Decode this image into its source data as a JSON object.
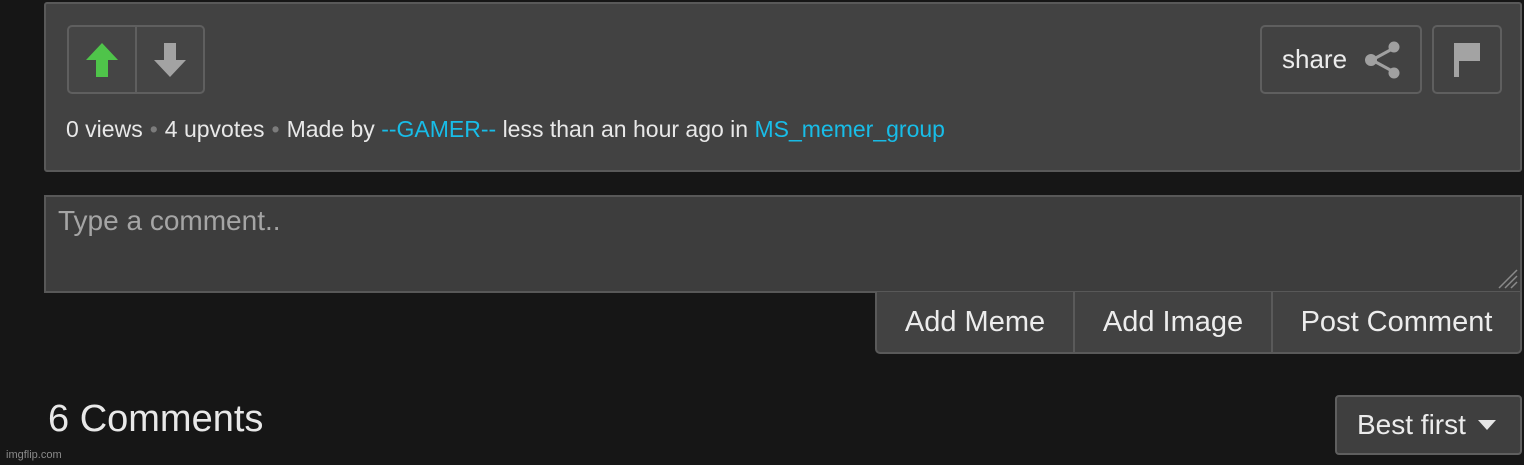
{
  "post": {
    "views": "0 views",
    "separator": "•",
    "upvotes": "4 upvotes",
    "made_by_label": "Made by",
    "author": "--GAMER--",
    "time_text": "less than an hour ago in",
    "stream": "MS_memer_group",
    "share_label": "share",
    "icons": {
      "upvote": "arrow-up-icon",
      "downvote": "arrow-down-icon",
      "share": "share-icon",
      "flag": "flag-icon"
    },
    "colors": {
      "upvote_active": "#4fc44a",
      "link": "#18bde8"
    }
  },
  "comment_form": {
    "placeholder": "Type a comment..",
    "value": "",
    "add_meme_label": "Add Meme",
    "add_image_label": "Add Image",
    "post_comment_label": "Post Comment"
  },
  "comments": {
    "count_label": "6 Comments",
    "sort_selected": "Best first"
  },
  "watermark": "imgflip.com"
}
